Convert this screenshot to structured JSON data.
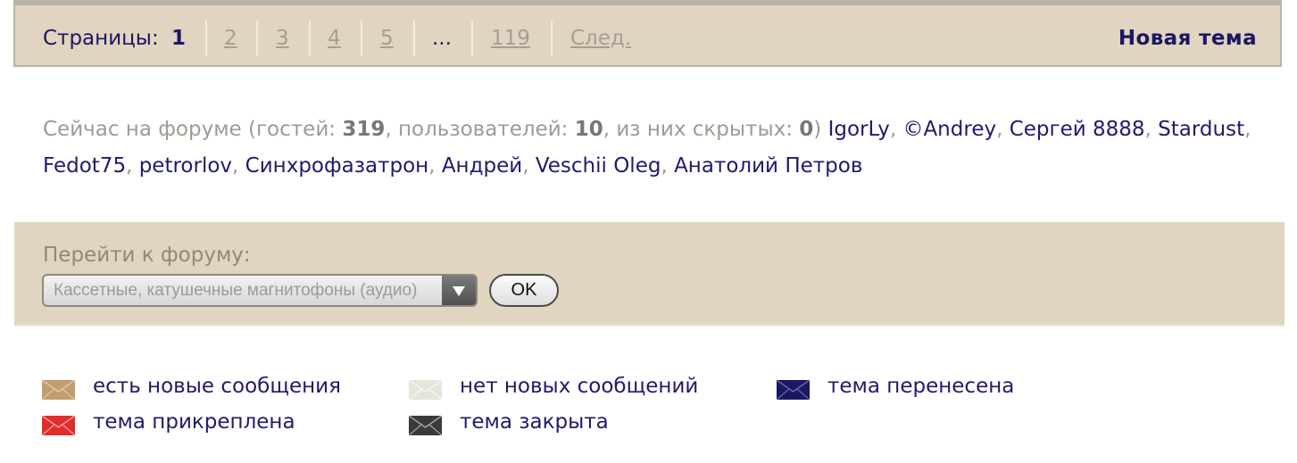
{
  "pagination": {
    "label": "Страницы:",
    "pages": [
      "1",
      "2",
      "3",
      "4",
      "5",
      "...",
      "119"
    ],
    "current": "1",
    "next": "След.",
    "new_topic": "Новая тема"
  },
  "online": {
    "prefix": "Сейчас на форуме (гостей: ",
    "guests": "319",
    "users_text": ", пользователей: ",
    "users": "10",
    "hidden_text": ", из них скрытых: ",
    "hidden": "0",
    "close": ")",
    "user_list": [
      "IgorLy",
      "©Andrey",
      "Сергей 8888",
      "Stardust",
      "Fedot75",
      "petrorlov",
      "Синхрофазатрон",
      "Андрей",
      "Veschii Oleg",
      "Анатолий Петров"
    ]
  },
  "jump": {
    "label": "Перейти к форуму:",
    "selected": "Кассетные, катушечные магнитофоны (аудио)",
    "ok_label": "OK"
  },
  "legend": [
    {
      "text": "есть новые сообщения",
      "icon": "envelope-new-icon",
      "color": "#c29d6e"
    },
    {
      "text": "нет новых сообщений",
      "icon": "envelope-no-new-icon",
      "color": "#e3e6da"
    },
    {
      "text": "тема перенесена",
      "icon": "envelope-moved-icon",
      "color": "#1b1763"
    },
    {
      "text": "тема прикреплена",
      "icon": "envelope-pinned-icon",
      "color": "#e22b2b"
    },
    {
      "text": "тема закрыта",
      "icon": "envelope-closed-icon",
      "color": "#3a3a3a"
    }
  ]
}
